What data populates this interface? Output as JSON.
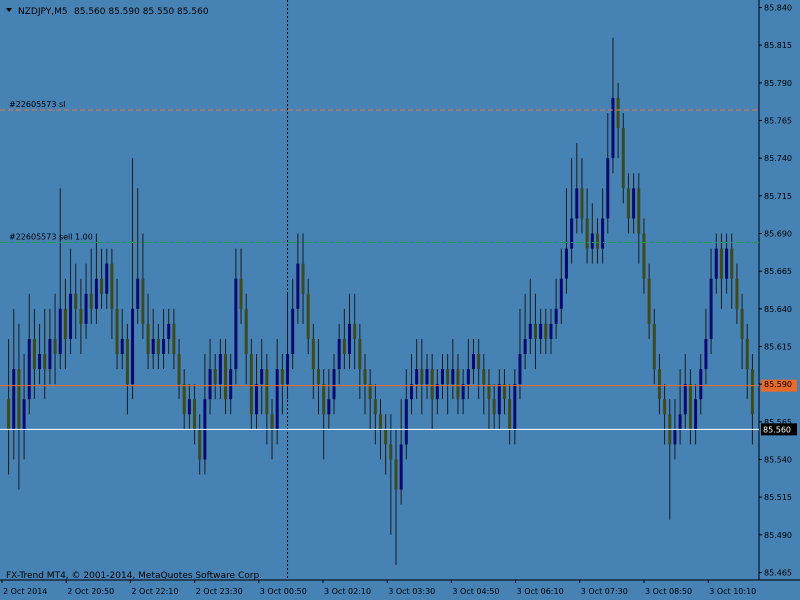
{
  "header": {
    "symbol_timeframe": "NZDJPY,M5",
    "ohlc": "85.560 85.590 85.550 85.560"
  },
  "copyright": "FX-Trend MT4, © 2001-2014, MetaQuotes Software Corp.",
  "order_lines": [
    {
      "label": "#22605573 sl",
      "price": 85.772,
      "color": "#e0784a",
      "style": "dashed"
    },
    {
      "label": "#22605573 sell 1.00",
      "price": 85.684,
      "color": "#1f9d3a",
      "style": "dashdot"
    }
  ],
  "price_markers": [
    {
      "text": "85.589",
      "price": 85.589,
      "line_color": "#e86a2a",
      "tag_bg": "#e86a2a",
      "tag_fg": "#e86a2a"
    },
    {
      "text": "85.560",
      "price": 85.56,
      "line_color": "#ffffff",
      "tag_bg": "#000000",
      "tag_fg": "#ffffff"
    }
  ],
  "colors": {
    "background": "#4682b4",
    "bull_body": "#0a0a6e",
    "bear_body": "#3c4a1e",
    "wick": "#1c1c1c",
    "grid_line": "#000000",
    "text": "#000000"
  },
  "chart_data": {
    "type": "candlestick",
    "yaxis": {
      "min": 85.46,
      "max": 85.845,
      "ticks": [
        "85.840",
        "85.815",
        "85.790",
        "85.765",
        "85.740",
        "85.715",
        "85.690",
        "85.665",
        "85.640",
        "85.615",
        "85.590",
        "85.565",
        "85.540",
        "85.515",
        "85.490",
        "85.465"
      ]
    },
    "xaxis": {
      "ticks": [
        "2 Oct 2014",
        "2 Oct 20:50",
        "2 Oct 22:10",
        "2 Oct 23:30",
        "3 Oct 00:50",
        "3 Oct 02:10",
        "3 Oct 03:30",
        "3 Oct 04:50",
        "3 Oct 06:10",
        "3 Oct 07:30",
        "3 Oct 08:50",
        "3 Oct 10:10"
      ]
    },
    "period_separator_bar": 54,
    "candles": [
      [
        85.58,
        85.56,
        85.62,
        85.53
      ],
      [
        85.56,
        85.6,
        85.64,
        85.54
      ],
      [
        85.6,
        85.56,
        85.63,
        85.52
      ],
      [
        85.56,
        85.58,
        85.61,
        85.54
      ],
      [
        85.58,
        85.62,
        85.65,
        85.57
      ],
      [
        85.62,
        85.6,
        85.64,
        85.58
      ],
      [
        85.6,
        85.61,
        85.63,
        85.59
      ],
      [
        85.61,
        85.6,
        85.64,
        85.58
      ],
      [
        85.6,
        85.62,
        85.64,
        85.59
      ],
      [
        85.62,
        85.61,
        85.65,
        85.59
      ],
      [
        85.61,
        85.64,
        85.72,
        85.6
      ],
      [
        85.64,
        85.62,
        85.66,
        85.6
      ],
      [
        85.62,
        85.65,
        85.68,
        85.61
      ],
      [
        85.65,
        85.64,
        85.67,
        85.62
      ],
      [
        85.64,
        85.63,
        85.66,
        85.61
      ],
      [
        85.63,
        85.65,
        85.67,
        85.62
      ],
      [
        85.65,
        85.64,
        85.68,
        85.63
      ],
      [
        85.64,
        85.66,
        85.69,
        85.63
      ],
      [
        85.66,
        85.65,
        85.68,
        85.64
      ],
      [
        85.65,
        85.67,
        85.68,
        85.64
      ],
      [
        85.67,
        85.64,
        85.68,
        85.62
      ],
      [
        85.64,
        85.61,
        85.66,
        85.6
      ],
      [
        85.61,
        85.62,
        85.64,
        85.6
      ],
      [
        85.62,
        85.59,
        85.63,
        85.57
      ],
      [
        85.59,
        85.64,
        85.74,
        85.58
      ],
      [
        85.64,
        85.66,
        85.72,
        85.63
      ],
      [
        85.66,
        85.63,
        85.69,
        85.62
      ],
      [
        85.63,
        85.61,
        85.65,
        85.6
      ],
      [
        85.61,
        85.62,
        85.64,
        85.6
      ],
      [
        85.62,
        85.61,
        85.63,
        85.6
      ],
      [
        85.61,
        85.62,
        85.64,
        85.6
      ],
      [
        85.62,
        85.63,
        85.64,
        85.61
      ],
      [
        85.63,
        85.61,
        85.64,
        85.6
      ],
      [
        85.61,
        85.59,
        85.62,
        85.58
      ],
      [
        85.59,
        85.57,
        85.6,
        85.56
      ],
      [
        85.57,
        85.58,
        85.59,
        85.56
      ],
      [
        85.58,
        85.56,
        85.59,
        85.55
      ],
      [
        85.56,
        85.54,
        85.57,
        85.53
      ],
      [
        85.54,
        85.58,
        85.61,
        85.53
      ],
      [
        85.58,
        85.6,
        85.62,
        85.57
      ],
      [
        85.6,
        85.59,
        85.61,
        85.58
      ],
      [
        85.59,
        85.61,
        85.62,
        85.58
      ],
      [
        85.61,
        85.58,
        85.62,
        85.57
      ],
      [
        85.58,
        85.6,
        85.61,
        85.57
      ],
      [
        85.6,
        85.66,
        85.68,
        85.59
      ],
      [
        85.66,
        85.64,
        85.68,
        85.63
      ],
      [
        85.64,
        85.61,
        85.65,
        85.59
      ],
      [
        85.61,
        85.57,
        85.62,
        85.56
      ],
      [
        85.57,
        85.59,
        85.61,
        85.56
      ],
      [
        85.59,
        85.6,
        85.62,
        85.57
      ],
      [
        85.6,
        85.57,
        85.61,
        85.55
      ],
      [
        85.57,
        85.56,
        85.58,
        85.54
      ],
      [
        85.56,
        85.6,
        85.62,
        85.55
      ],
      [
        85.6,
        85.59,
        85.61,
        85.57
      ],
      [
        85.59,
        85.61,
        85.65,
        85.58
      ],
      [
        85.61,
        85.64,
        85.66,
        85.6
      ],
      [
        85.64,
        85.67,
        85.69,
        85.63
      ],
      [
        85.67,
        85.65,
        85.69,
        85.63
      ],
      [
        85.65,
        85.62,
        85.66,
        85.61
      ],
      [
        85.62,
        85.6,
        85.63,
        85.58
      ],
      [
        85.6,
        85.59,
        85.62,
        85.57
      ],
      [
        85.59,
        85.57,
        85.6,
        85.54
      ],
      [
        85.57,
        85.58,
        85.6,
        85.56
      ],
      [
        85.58,
        85.6,
        85.61,
        85.57
      ],
      [
        85.6,
        85.62,
        85.63,
        85.59
      ],
      [
        85.62,
        85.61,
        85.64,
        85.6
      ],
      [
        85.61,
        85.63,
        85.65,
        85.6
      ],
      [
        85.63,
        85.62,
        85.65,
        85.6
      ],
      [
        85.62,
        85.6,
        85.63,
        85.58
      ],
      [
        85.6,
        85.59,
        85.61,
        85.57
      ],
      [
        85.59,
        85.58,
        85.6,
        85.56
      ],
      [
        85.58,
        85.57,
        85.59,
        85.55
      ],
      [
        85.57,
        85.56,
        85.58,
        85.54
      ],
      [
        85.56,
        85.55,
        85.57,
        85.53
      ],
      [
        85.55,
        85.54,
        85.57,
        85.49
      ],
      [
        85.54,
        85.52,
        85.56,
        85.47
      ],
      [
        85.52,
        85.55,
        85.58,
        85.51
      ],
      [
        85.55,
        85.58,
        85.6,
        85.54
      ],
      [
        85.58,
        85.59,
        85.61,
        85.57
      ],
      [
        85.59,
        85.6,
        85.62,
        85.58
      ],
      [
        85.6,
        85.59,
        85.62,
        85.57
      ],
      [
        85.59,
        85.6,
        85.61,
        85.58
      ],
      [
        85.6,
        85.58,
        85.61,
        85.56
      ],
      [
        85.58,
        85.59,
        85.6,
        85.57
      ],
      [
        85.59,
        85.6,
        85.61,
        85.58
      ],
      [
        85.6,
        85.59,
        85.61,
        85.57
      ],
      [
        85.59,
        85.6,
        85.62,
        85.58
      ],
      [
        85.6,
        85.58,
        85.61,
        85.57
      ],
      [
        85.58,
        85.59,
        85.6,
        85.57
      ],
      [
        85.59,
        85.6,
        85.62,
        85.58
      ],
      [
        85.6,
        85.61,
        85.62,
        85.59
      ],
      [
        85.61,
        85.6,
        85.62,
        85.58
      ],
      [
        85.6,
        85.59,
        85.61,
        85.57
      ],
      [
        85.59,
        85.58,
        85.6,
        85.56
      ],
      [
        85.58,
        85.57,
        85.59,
        85.56
      ],
      [
        85.57,
        85.59,
        85.6,
        85.56
      ],
      [
        85.59,
        85.58,
        85.6,
        85.57
      ],
      [
        85.58,
        85.56,
        85.59,
        85.55
      ],
      [
        85.56,
        85.59,
        85.6,
        85.55
      ],
      [
        85.59,
        85.61,
        85.64,
        85.58
      ],
      [
        85.61,
        85.62,
        85.65,
        85.6
      ],
      [
        85.62,
        85.63,
        85.66,
        85.61
      ],
      [
        85.63,
        85.62,
        85.65,
        85.6
      ],
      [
        85.62,
        85.63,
        85.64,
        85.61
      ],
      [
        85.63,
        85.62,
        85.64,
        85.61
      ],
      [
        85.62,
        85.63,
        85.64,
        85.61
      ],
      [
        85.63,
        85.64,
        85.66,
        85.62
      ],
      [
        85.64,
        85.66,
        85.68,
        85.63
      ],
      [
        85.66,
        85.68,
        85.72,
        85.65
      ],
      [
        85.68,
        85.7,
        85.74,
        85.67
      ],
      [
        85.7,
        85.72,
        85.75,
        85.69
      ],
      [
        85.72,
        85.7,
        85.74,
        85.69
      ],
      [
        85.7,
        85.68,
        85.72,
        85.67
      ],
      [
        85.68,
        85.69,
        85.71,
        85.67
      ],
      [
        85.69,
        85.68,
        85.7,
        85.67
      ],
      [
        85.68,
        85.7,
        85.72,
        85.67
      ],
      [
        85.7,
        85.74,
        85.77,
        85.69
      ],
      [
        85.74,
        85.78,
        85.82,
        85.73
      ],
      [
        85.78,
        85.76,
        85.79,
        85.74
      ],
      [
        85.76,
        85.72,
        85.77,
        85.71
      ],
      [
        85.72,
        85.7,
        85.73,
        85.69
      ],
      [
        85.7,
        85.72,
        85.73,
        85.69
      ],
      [
        85.72,
        85.69,
        85.73,
        85.67
      ],
      [
        85.69,
        85.66,
        85.7,
        85.65
      ],
      [
        85.66,
        85.63,
        85.67,
        85.62
      ],
      [
        85.63,
        85.6,
        85.64,
        85.59
      ],
      [
        85.6,
        85.58,
        85.61,
        85.57
      ],
      [
        85.58,
        85.57,
        85.59,
        85.55
      ],
      [
        85.57,
        85.55,
        85.58,
        85.5
      ],
      [
        85.55,
        85.56,
        85.58,
        85.54
      ],
      [
        85.56,
        85.57,
        85.6,
        85.55
      ],
      [
        85.57,
        85.59,
        85.61,
        85.56
      ],
      [
        85.59,
        85.56,
        85.6,
        85.55
      ],
      [
        85.56,
        85.58,
        85.59,
        85.55
      ],
      [
        85.58,
        85.6,
        85.61,
        85.57
      ],
      [
        85.6,
        85.62,
        85.64,
        85.59
      ],
      [
        85.62,
        85.66,
        85.68,
        85.61
      ],
      [
        85.66,
        85.68,
        85.69,
        85.65
      ],
      [
        85.68,
        85.66,
        85.69,
        85.64
      ],
      [
        85.66,
        85.68,
        85.69,
        85.65
      ],
      [
        85.68,
        85.66,
        85.69,
        85.64
      ],
      [
        85.66,
        85.64,
        85.67,
        85.63
      ],
      [
        85.64,
        85.62,
        85.65,
        85.6
      ],
      [
        85.62,
        85.6,
        85.63,
        85.58
      ],
      [
        85.6,
        85.57,
        85.61,
        85.55
      ]
    ]
  }
}
